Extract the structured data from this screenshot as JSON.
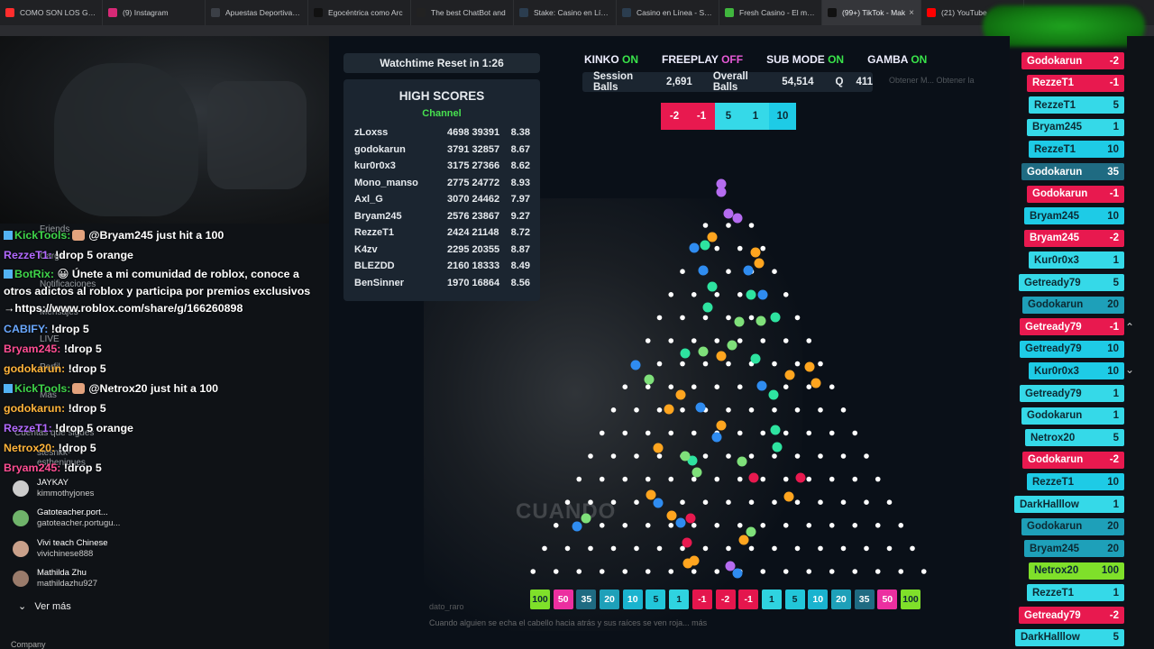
{
  "browser": {
    "tabs": [
      {
        "label": "COMO SON LOS GUA",
        "icon_color": "#ff2d2d"
      },
      {
        "label": "(9) Instagram",
        "icon_color": "#d62976"
      },
      {
        "label": "Apuestas Deportivas O",
        "icon_color": "#3b3f46"
      },
      {
        "label": "Egocéntrica como Arc",
        "icon_color": "#111111"
      },
      {
        "label": "The best ChatBot and",
        "icon_color": "#222222"
      },
      {
        "label": "Stake: Casino en Línea",
        "icon_color": "#2b3d4f"
      },
      {
        "label": "Casino en Línea - Slots",
        "icon_color": "#2b3d4f"
      },
      {
        "label": "Fresh Casino - El mejo",
        "icon_color": "#40b63e"
      },
      {
        "label": "(99+) TikTok - Mak",
        "icon_color": "#111111",
        "active": true
      },
      {
        "label": "(21) YouTube",
        "icon_color": "#ff0000"
      }
    ],
    "close_glyph": "×"
  },
  "side_menu_ghost": {
    "friends": "Friends",
    "carga": "Carga",
    "notificaciones": "Notificaciones",
    "mensajes": "Mensajes",
    "live": "LIVE",
    "perfil": "Perfil",
    "mas": "Más",
    "cuentas": "Cuentas que sigues",
    "stesnkk": "stesnkk-",
    "estheniques": "estheniques"
  },
  "chat": [
    {
      "user": "KickTools:",
      "user_color": "#3fd54a",
      "has_badge": true,
      "has_face": true,
      "text": "@Bryam245 just hit a 100"
    },
    {
      "user": "RezzeT1:",
      "user_color": "#b269ff",
      "text": "!drop 5 orange"
    },
    {
      "user": "BotRix:",
      "user_color": "#3fd54a",
      "has_badge": true,
      "text": "😀 Únete a mi comunidad de roblox, conoce a otros adictos al roblox y participa por premios exclusivos →https://www.roblox.com/share/g/166260898",
      "wrap": true
    },
    {
      "user": "CABIFY:",
      "user_color": "#6aa8ff",
      "text": "!drop 5"
    },
    {
      "user": "Bryam245:",
      "user_color": "#ff4e93",
      "text": "!drop 5"
    },
    {
      "user": "godokarun:",
      "user_color": "#ffb43a",
      "text": "!drop 5"
    },
    {
      "user": "KickTools:",
      "user_color": "#3fd54a",
      "has_badge": true,
      "has_face": true,
      "text": "@Netrox20 just hit a 100"
    },
    {
      "user": "godokarun:",
      "user_color": "#ffb43a",
      "text": "!drop 5"
    },
    {
      "user": "RezzeT1:",
      "user_color": "#b269ff",
      "text": "!drop 5 orange"
    },
    {
      "user": "Netrox20:",
      "user_color": "#ffb43a",
      "text": "!drop 5"
    },
    {
      "user": "Bryam245:",
      "user_color": "#ff4e93",
      "text": "!drop 5"
    }
  ],
  "following": [
    {
      "name": "JAYKAY",
      "handle": "kimmothyjones",
      "color": "#cccccc"
    },
    {
      "name": "Gatoteacher.port...",
      "handle": "gatoteacher.portugu...",
      "color": "#6fb36a"
    },
    {
      "name": "Vivi teach Chinese",
      "handle": "vivichinese888",
      "color": "#c9a08a"
    },
    {
      "name": "Mathilda Zhu",
      "handle": "mathildazhu927",
      "color": "#9a7b6b"
    }
  ],
  "ver_mas": "Ver más",
  "company": "Company",
  "game": {
    "watchtime": "Watchtime Reset in 1:26",
    "high_scores": {
      "title": "HIGH SCORES",
      "subtitle": "Channel",
      "rows": [
        {
          "name": "zLoxss",
          "score": "4698 39391",
          "ratio": "8.38"
        },
        {
          "name": "godokarun",
          "score": "3791 32857",
          "ratio": "8.67"
        },
        {
          "name": "kur0r0x3",
          "score": "3175 27366",
          "ratio": "8.62"
        },
        {
          "name": "Mono_manso",
          "score": "2775 24772",
          "ratio": "8.93"
        },
        {
          "name": "Axl_G",
          "score": "3070 24462",
          "ratio": "7.97"
        },
        {
          "name": "Bryam245",
          "score": "2576 23867",
          "ratio": "9.27"
        },
        {
          "name": "RezzeT1",
          "score": "2424 21148",
          "ratio": "8.72"
        },
        {
          "name": "K4zv",
          "score": "2295 20355",
          "ratio": "8.87"
        },
        {
          "name": "BLEZDD",
          "score": "2160 18333",
          "ratio": "8.49"
        },
        {
          "name": "BenSinner",
          "score": "1970 16864",
          "ratio": "8.56"
        }
      ]
    },
    "flags": [
      {
        "label": "KINKO",
        "state": "ON"
      },
      {
        "label": "FREEPLAY",
        "state": "OFF"
      },
      {
        "label": "SUB MODE",
        "state": "ON"
      },
      {
        "label": "GAMBA",
        "state": "ON"
      }
    ],
    "stats": {
      "session_label": "Session Balls",
      "session_value": "2,691",
      "overall_label": "Overall Balls",
      "overall_value": "54,514",
      "q_label": "Q",
      "q_value": "411"
    },
    "recent": [
      {
        "v": "-2",
        "color": "#e8194f"
      },
      {
        "v": "-1",
        "color": "#e8194f"
      },
      {
        "v": "5",
        "color": "#35d9e8"
      },
      {
        "v": "1",
        "color": "#35d9e8"
      },
      {
        "v": "10",
        "color": "#1ecbe6"
      }
    ],
    "slots": [
      {
        "v": "100",
        "color": "#7fe02a"
      },
      {
        "v": "50",
        "color": "#ec2fa0"
      },
      {
        "v": "35",
        "color": "#1f6b82"
      },
      {
        "v": "20",
        "color": "#1ea0b9"
      },
      {
        "v": "10",
        "color": "#1ab3cf"
      },
      {
        "v": "5",
        "color": "#22c6d9"
      },
      {
        "v": "1",
        "color": "#2fd3e0"
      },
      {
        "v": "-1",
        "color": "#e4164d"
      },
      {
        "v": "-2",
        "color": "#e4164d"
      },
      {
        "v": "-1",
        "color": "#e4164d"
      },
      {
        "v": "1",
        "color": "#2fd3e0"
      },
      {
        "v": "5",
        "color": "#22c6d9"
      },
      {
        "v": "10",
        "color": "#1ab3cf"
      },
      {
        "v": "20",
        "color": "#1ea0b9"
      },
      {
        "v": "35",
        "color": "#1f6b82"
      },
      {
        "v": "50",
        "color": "#ec2fa0"
      },
      {
        "v": "100",
        "color": "#7fe02a"
      }
    ],
    "ghost_text": "CUANDO",
    "ghost_cap1": "dato_raro",
    "ghost_cap2": "Cuando alguien se echa el cabello hacia atrás y sus raíces se ven roja... más",
    "ghost_right": "Obtener M...   Obtener la"
  },
  "feed": [
    {
      "name": "Godokarun",
      "v": "-2",
      "color": "#e8194f",
      "text": "#ffffff"
    },
    {
      "name": "RezzeT1",
      "v": "-1",
      "color": "#e8194f",
      "text": "#ffffff"
    },
    {
      "name": "RezzeT1",
      "v": "5",
      "color": "#35d9e8",
      "text": "#0c2a33"
    },
    {
      "name": "Bryam245",
      "v": "1",
      "color": "#35d9e8",
      "text": "#0c2a33"
    },
    {
      "name": "RezzeT1",
      "v": "10",
      "color": "#1ecbe6",
      "text": "#0c2a33"
    },
    {
      "name": "Godokarun",
      "v": "35",
      "color": "#1f6b82",
      "text": "#ffffff"
    },
    {
      "name": "Godokarun",
      "v": "-1",
      "color": "#e8194f",
      "text": "#ffffff"
    },
    {
      "name": "Bryam245",
      "v": "10",
      "color": "#1ecbe6",
      "text": "#0c2a33"
    },
    {
      "name": "Bryam245",
      "v": "-2",
      "color": "#e8194f",
      "text": "#ffffff"
    },
    {
      "name": "Kur0r0x3",
      "v": "1",
      "color": "#35d9e8",
      "text": "#0c2a33"
    },
    {
      "name": "Getready79",
      "v": "5",
      "color": "#35d9e8",
      "text": "#0c2a33"
    },
    {
      "name": "Godokarun",
      "v": "20",
      "color": "#1ea0b9",
      "text": "#0c2a33"
    },
    {
      "name": "Getready79",
      "v": "-1",
      "color": "#e8194f",
      "text": "#ffffff"
    },
    {
      "name": "Getready79",
      "v": "10",
      "color": "#1ecbe6",
      "text": "#0c2a33"
    },
    {
      "name": "Kur0r0x3",
      "v": "10",
      "color": "#1ecbe6",
      "text": "#0c2a33"
    },
    {
      "name": "Getready79",
      "v": "1",
      "color": "#35d9e8",
      "text": "#0c2a33"
    },
    {
      "name": "Godokarun",
      "v": "1",
      "color": "#35d9e8",
      "text": "#0c2a33"
    },
    {
      "name": "Netrox20",
      "v": "5",
      "color": "#35d9e8",
      "text": "#0c2a33"
    },
    {
      "name": "Godokarun",
      "v": "-2",
      "color": "#e8194f",
      "text": "#ffffff"
    },
    {
      "name": "RezzeT1",
      "v": "10",
      "color": "#1ecbe6",
      "text": "#0c2a33"
    },
    {
      "name": "DarkHalllow",
      "v": "1",
      "color": "#35d9e8",
      "text": "#0c2a33"
    },
    {
      "name": "Godokarun",
      "v": "20",
      "color": "#1ea0b9",
      "text": "#0c2a33"
    },
    {
      "name": "Bryam245",
      "v": "20",
      "color": "#1ea0b9",
      "text": "#0c2a33"
    },
    {
      "name": "Netrox20",
      "v": "100",
      "color": "#7fe02a",
      "text": "#0c2a33"
    },
    {
      "name": "RezzeT1",
      "v": "1",
      "color": "#35d9e8",
      "text": "#0c2a33"
    },
    {
      "name": "Getready79",
      "v": "-2",
      "color": "#e8194f",
      "text": "#ffffff"
    },
    {
      "name": "DarkHalllow",
      "v": "5",
      "color": "#35d9e8",
      "text": "#0c2a33"
    }
  ]
}
